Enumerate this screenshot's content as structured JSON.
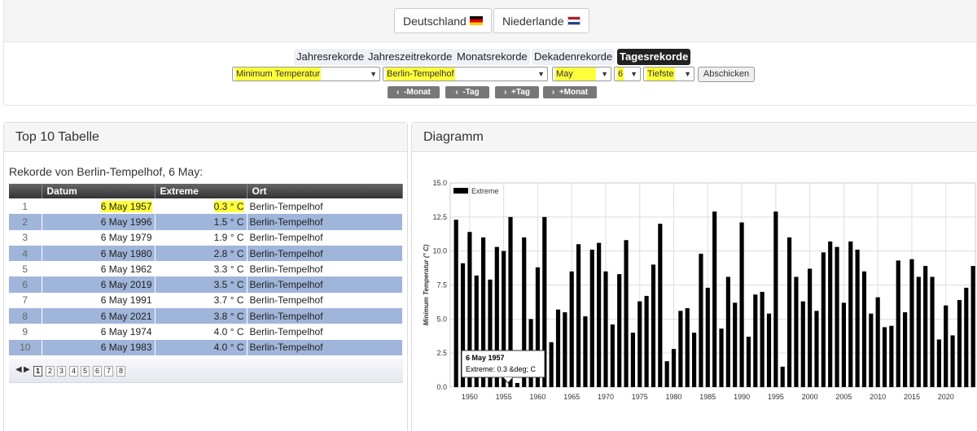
{
  "countries": [
    {
      "label": "Deutschland",
      "flag": "de-flag-icon"
    },
    {
      "label": "Niederlande",
      "flag": "nl-flag-icon"
    }
  ],
  "tabs": [
    "Jahresrekorde",
    "Jahreszeitrekorde",
    "Monatsrekorde",
    "Dekadenrekorde",
    "Tagesrekorde"
  ],
  "active_tab": "Tagesrekorde",
  "filters": {
    "parameter": "Minimum Temperatur",
    "station": "Berlin-Tempelhof",
    "month": "May",
    "day": "6",
    "mode": "Tiefste",
    "submit": "Abschicken"
  },
  "nav_buttons": [
    "-Monat",
    "-Tag",
    "+Tag",
    "+Monat"
  ],
  "table_panel": {
    "title": "Top 10 Tabelle",
    "caption": "Rekorde von Berlin-Tempelhof, 6 May:",
    "headers": [
      "",
      "Datum",
      "Extreme",
      "Ort"
    ],
    "rows": [
      {
        "rank": "1",
        "datum": "6 May 1957",
        "extreme": "0.3 ° C",
        "ort": "Berlin-Tempelhof"
      },
      {
        "rank": "2",
        "datum": "6 May 1996",
        "extreme": "1.5 ° C",
        "ort": "Berlin-Tempelhof"
      },
      {
        "rank": "3",
        "datum": "6 May 1979",
        "extreme": "1.9 ° C",
        "ort": "Berlin-Tempelhof"
      },
      {
        "rank": "4",
        "datum": "6 May 1980",
        "extreme": "2.8 ° C",
        "ort": "Berlin-Tempelhof"
      },
      {
        "rank": "5",
        "datum": "6 May 1962",
        "extreme": "3.3 ° C",
        "ort": "Berlin-Tempelhof"
      },
      {
        "rank": "6",
        "datum": "6 May 2019",
        "extreme": "3.5 ° C",
        "ort": "Berlin-Tempelhof"
      },
      {
        "rank": "7",
        "datum": "6 May 1991",
        "extreme": "3.7 ° C",
        "ort": "Berlin-Tempelhof"
      },
      {
        "rank": "8",
        "datum": "6 May 2021",
        "extreme": "3.8 ° C",
        "ort": "Berlin-Tempelhof"
      },
      {
        "rank": "9",
        "datum": "6 May 1974",
        "extreme": "4.0 ° C",
        "ort": "Berlin-Tempelhof"
      },
      {
        "rank": "10",
        "datum": "6 May 1983",
        "extreme": "4.0 ° C",
        "ort": "Berlin-Tempelhof"
      }
    ],
    "pages": [
      "1",
      "2",
      "3",
      "4",
      "5",
      "6",
      "7",
      "8"
    ],
    "current_page": "1"
  },
  "chart_panel": {
    "title": "Diagramm",
    "tooltip": {
      "title": "6 May 1957",
      "body": "Extreme: 0.3 &deg; C"
    }
  },
  "chart_data": {
    "type": "bar",
    "legend": [
      "Extreme"
    ],
    "legend_position": "top-left",
    "ylabel": "Minimum  Temperatur  (° C)",
    "ylim": [
      0,
      15
    ],
    "yticks": [
      "0.0",
      "2.5",
      "5.0",
      "7.5",
      "10.0",
      "12.5",
      "15.0"
    ],
    "xticks": [
      "1950",
      "1955",
      "1960",
      "1965",
      "1970",
      "1975",
      "1980",
      "1985",
      "1990",
      "1995",
      "2000",
      "2005",
      "2010",
      "2015",
      "2020"
    ],
    "grid": true,
    "x": [
      1948,
      1949,
      1950,
      1951,
      1952,
      1953,
      1954,
      1955,
      1956,
      1957,
      1958,
      1959,
      1960,
      1961,
      1962,
      1963,
      1964,
      1965,
      1966,
      1967,
      1968,
      1969,
      1970,
      1971,
      1972,
      1973,
      1974,
      1975,
      1976,
      1977,
      1978,
      1979,
      1980,
      1981,
      1982,
      1983,
      1984,
      1985,
      1986,
      1987,
      1988,
      1989,
      1990,
      1991,
      1992,
      1993,
      1994,
      1995,
      1996,
      1997,
      1998,
      1999,
      2000,
      2001,
      2002,
      2003,
      2004,
      2005,
      2006,
      2007,
      2008,
      2009,
      2010,
      2011,
      2012,
      2013,
      2014,
      2015,
      2016,
      2017,
      2018,
      2019,
      2020,
      2021,
      2022,
      2023,
      2024
    ],
    "values": [
      12.3,
      9.1,
      11.4,
      8.2,
      11.0,
      7.9,
      10.3,
      10.0,
      12.5,
      0.3,
      11.0,
      5.0,
      8.8,
      12.5,
      3.3,
      5.7,
      5.5,
      8.5,
      10.5,
      5.2,
      10.1,
      10.6,
      8.5,
      4.6,
      8.3,
      10.8,
      4.0,
      6.3,
      6.7,
      9.0,
      12.0,
      1.9,
      2.8,
      5.6,
      5.8,
      4.0,
      9.8,
      7.3,
      12.9,
      4.3,
      8.1,
      6.2,
      12.1,
      3.7,
      6.8,
      7.0,
      5.4,
      12.9,
      1.5,
      11.0,
      8.1,
      6.3,
      8.7,
      5.6,
      9.9,
      10.7,
      10.3,
      6.2,
      10.7,
      10.1,
      8.5,
      5.4,
      6.6,
      4.4,
      4.5,
      9.3,
      5.5,
      9.4,
      8.1,
      8.9,
      8.1,
      3.5,
      6.0,
      3.8,
      6.4,
      7.3,
      8.9
    ]
  }
}
